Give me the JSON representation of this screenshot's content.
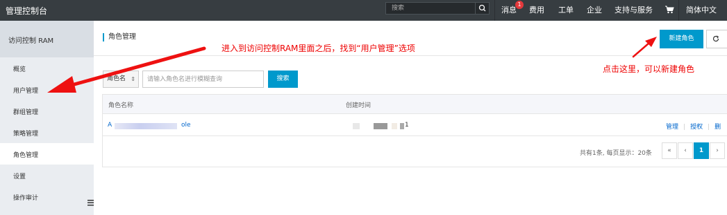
{
  "topbar": {
    "brand": "管理控制台",
    "search_placeholder": "搜索",
    "nav": {
      "messages": "消息",
      "message_count": "1",
      "billing": "费用",
      "tickets": "工单",
      "enterprise": "企业",
      "support": "支持与服务",
      "language": "简体中文"
    },
    "icons": {
      "search": "search-icon",
      "cart": "cart-icon"
    }
  },
  "sidebar": {
    "title": "访问控制 RAM",
    "items": [
      {
        "label": "概览"
      },
      {
        "label": "用户管理"
      },
      {
        "label": "群组管理"
      },
      {
        "label": "策略管理"
      },
      {
        "label": "角色管理",
        "active": true
      },
      {
        "label": "设置"
      },
      {
        "label": "操作审计"
      }
    ]
  },
  "main": {
    "title": "角色管理",
    "new_role_button": "新建角色",
    "refresh_icon": "refresh-icon",
    "filter": {
      "select_value": "角色名",
      "keyword_placeholder": "请输入角色名进行模糊查询",
      "search_button": "搜索"
    },
    "table": {
      "columns": [
        "角色名称",
        "创建时间"
      ],
      "rows": [
        {
          "name_prefix": "A",
          "name_suffix": "ole",
          "created_suffix": "1",
          "actions": [
            "管理",
            "授权",
            "删"
          ]
        }
      ]
    },
    "pagination": {
      "summary": "共有1条, 每页显示：20条",
      "first": "«",
      "prev": "‹",
      "current": "1",
      "next": "›"
    }
  },
  "annotations": {
    "left_note": "进入到访问控制RAM里面之后，找到“用户管理”选项",
    "right_note": "点击这里，可以新建角色"
  },
  "colors": {
    "topbar_bg": "#373d41",
    "accent": "#0099cc",
    "annotation": "#ee0000",
    "badge": "#e4393c"
  }
}
